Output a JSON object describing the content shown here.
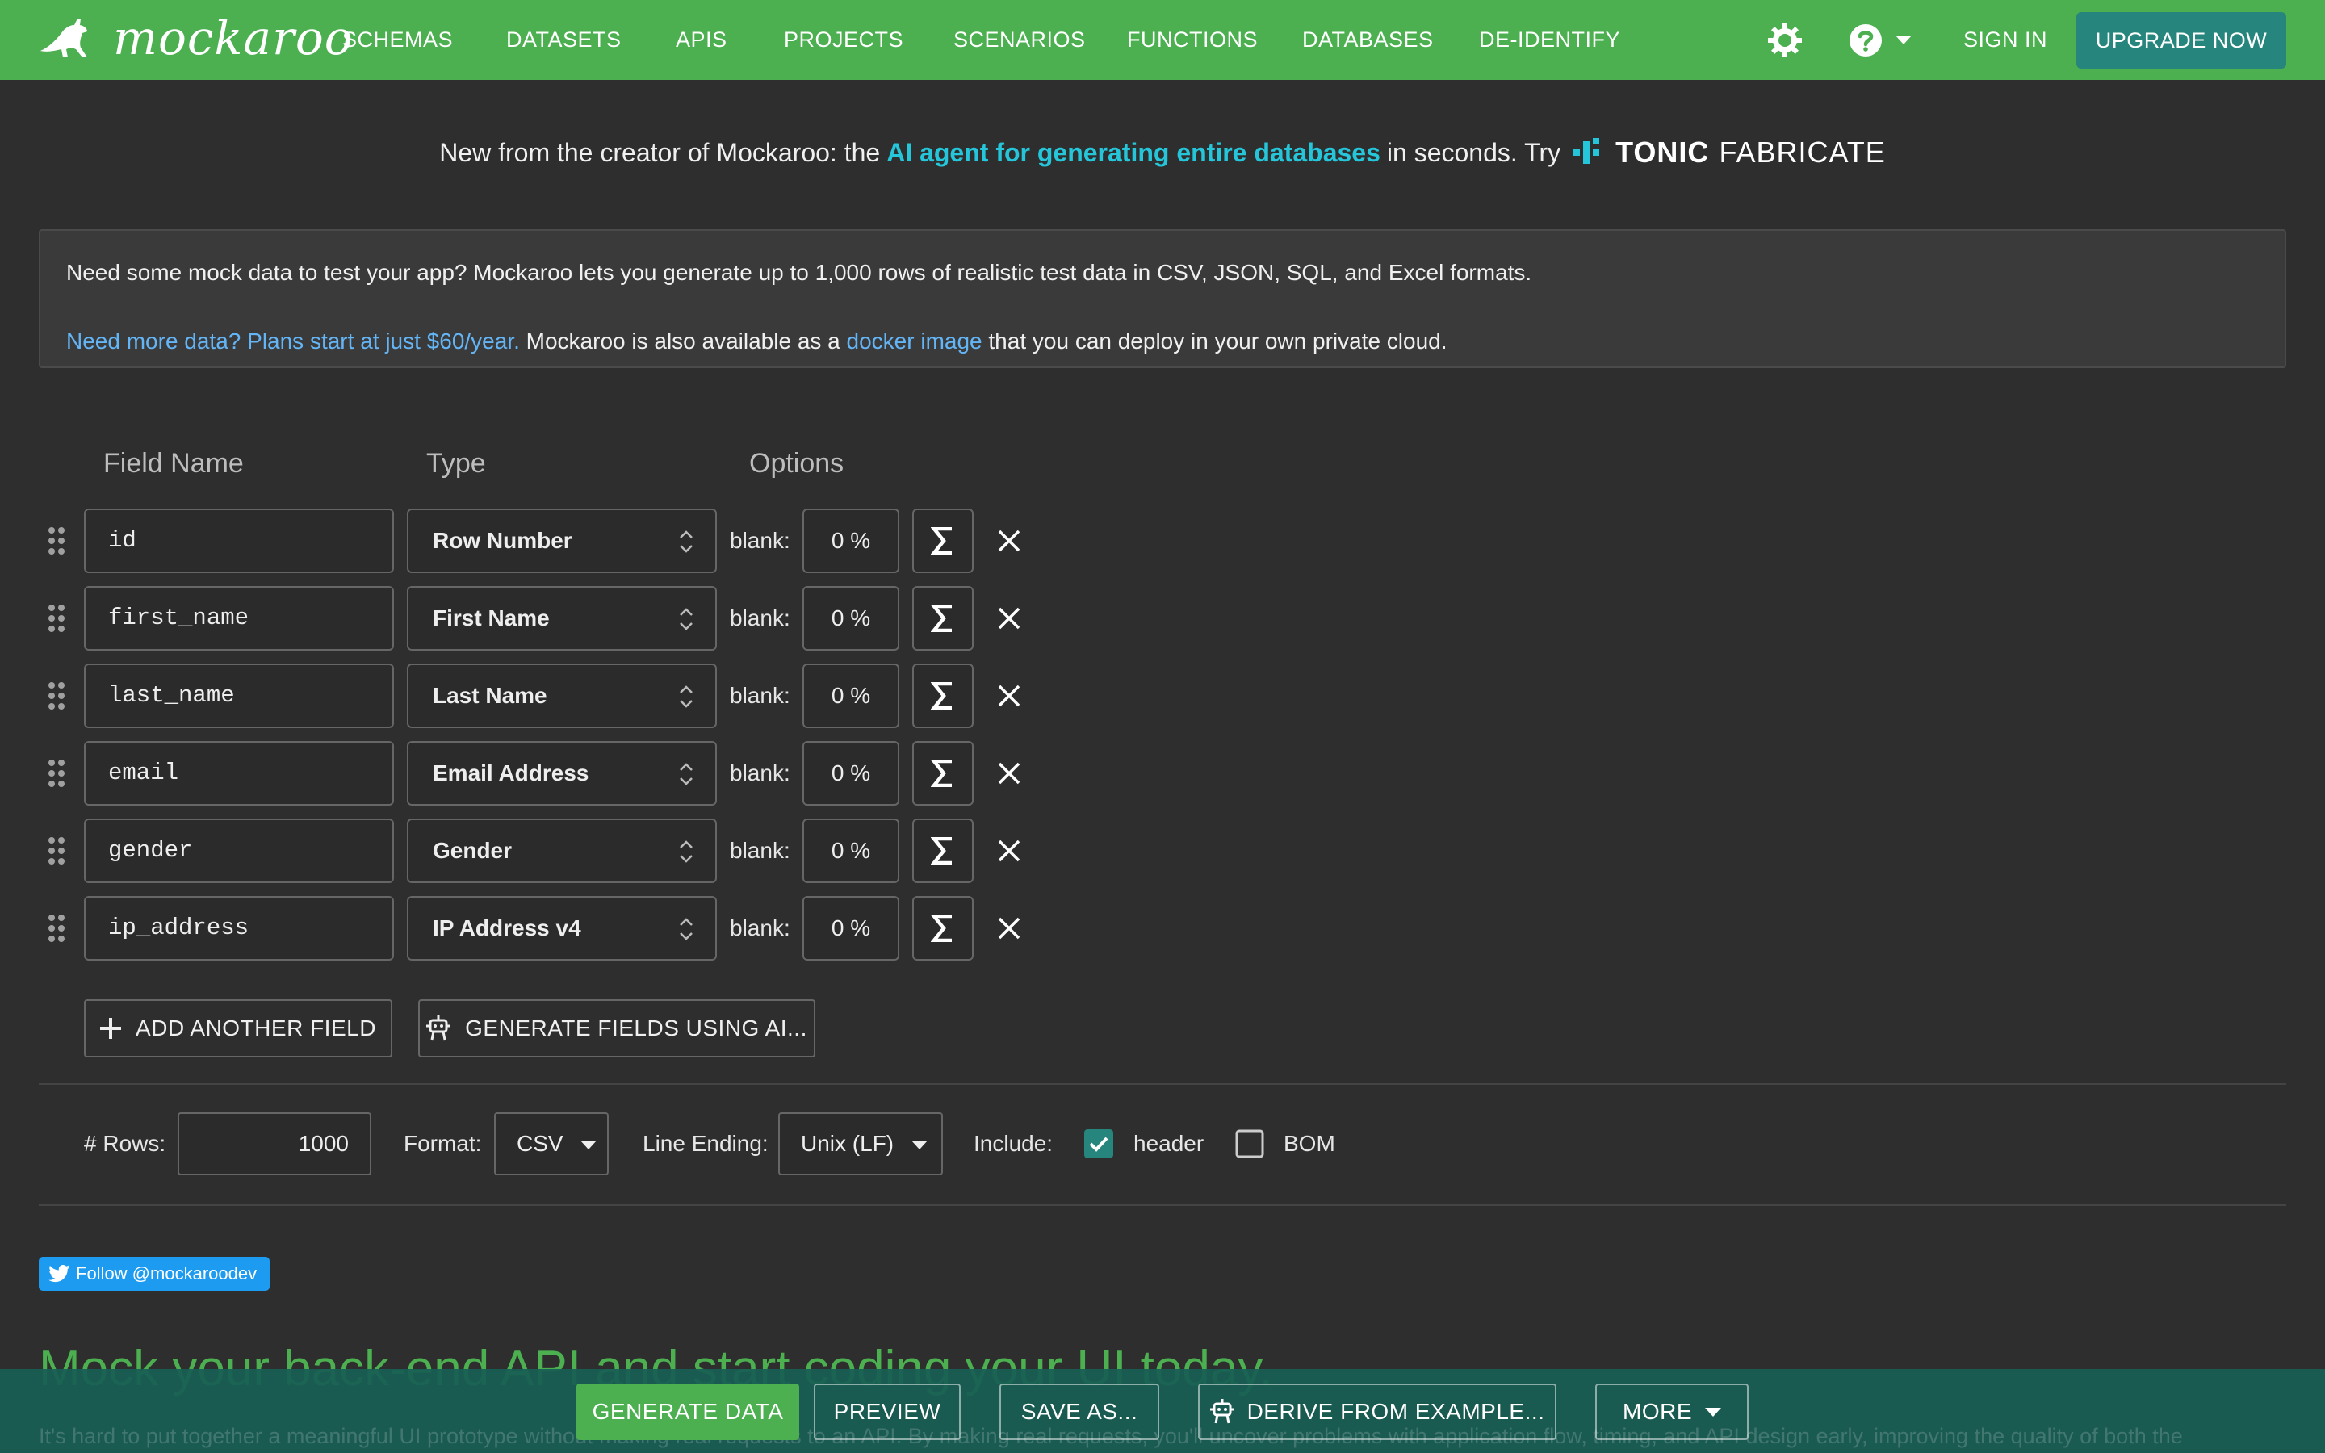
{
  "nav": {
    "brand": "mockaroo",
    "links": [
      "SCHEMAS",
      "DATASETS",
      "APIS",
      "PROJECTS",
      "SCENARIOS",
      "FUNCTIONS",
      "DATABASES",
      "DE-IDENTIFY"
    ],
    "sign_in": "SIGN IN",
    "upgrade": "UPGRADE NOW"
  },
  "announcement": {
    "prefix": "New from the creator of Mockaroo: the",
    "highlight": "AI agent for generating entire databases",
    "suffix": "in seconds. Try",
    "brand_tonic": "TONIC",
    "brand_fabricate": "FABRICATE"
  },
  "info": {
    "line1": "Need some mock data to test your app? Mockaroo lets you generate up to 1,000 rows of realistic test data in CSV, JSON, SQL, and Excel formats.",
    "plans_link": "Need more data? Plans start at just $60/year.",
    "docker_pre": "Mockaroo is also available as a",
    "docker_link": "docker image",
    "docker_post": "that you can deploy in your own private cloud."
  },
  "columns": {
    "field_name": "Field Name",
    "type": "Type",
    "options": "Options"
  },
  "fields": [
    {
      "name": "id",
      "type": "Row Number",
      "blank_label": "blank:",
      "blank": "0 %"
    },
    {
      "name": "first_name",
      "type": "First Name",
      "blank_label": "blank:",
      "blank": "0 %"
    },
    {
      "name": "last_name",
      "type": "Last Name",
      "blank_label": "blank:",
      "blank": "0 %"
    },
    {
      "name": "email",
      "type": "Email Address",
      "blank_label": "blank:",
      "blank": "0 %"
    },
    {
      "name": "gender",
      "type": "Gender",
      "blank_label": "blank:",
      "blank": "0 %"
    },
    {
      "name": "ip_address",
      "type": "IP Address v4",
      "blank_label": "blank:",
      "blank": "0 %"
    }
  ],
  "actions": {
    "add_field": "ADD ANOTHER FIELD",
    "generate_ai": "GENERATE FIELDS USING AI..."
  },
  "options": {
    "rows_label": "# Rows:",
    "rows_value": "1000",
    "format_label": "Format:",
    "format_value": "CSV",
    "line_ending_label": "Line Ending:",
    "line_ending_value": "Unix (LF)",
    "include_label": "Include:",
    "header_label": "header",
    "header_checked": true,
    "bom_label": "BOM",
    "bom_checked": false
  },
  "follow": "Follow @mockaroodev",
  "headline": "Mock your back-end API and start coding your UI today.",
  "subtext": "It's hard to put together a meaningful UI prototype without making real requests to an API. By making real requests, you'll uncover problems with application flow, timing, and API design early, improving the quality of both the",
  "bottom": {
    "generate": "GENERATE DATA",
    "preview": "PREVIEW",
    "save_as": "SAVE AS...",
    "derive": "DERIVE FROM EXAMPLE...",
    "more": "MORE"
  },
  "colors": {
    "nav_bg": "#4caf50",
    "accent_teal": "#26867e",
    "highlight": "#26c6da",
    "link": "#64b5f6",
    "bottom_bar": "#185e54"
  }
}
